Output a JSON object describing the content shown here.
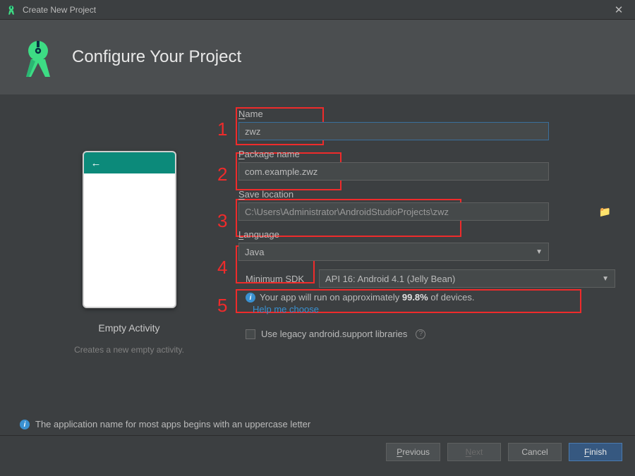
{
  "window": {
    "title": "Create New Project"
  },
  "header": {
    "title": "Configure Your Project"
  },
  "preview": {
    "template_name": "Empty Activity",
    "template_desc": "Creates a new empty activity."
  },
  "fields": {
    "name": {
      "label_pre": "N",
      "label_rest": "ame",
      "value": "zwz"
    },
    "package": {
      "label_pre": "P",
      "label_rest": "ackage name",
      "value": "com.example.zwz"
    },
    "location": {
      "label_pre": "S",
      "label_rest": "ave location",
      "value": "C:\\Users\\Administrator\\AndroidStudioProjects\\zwz"
    },
    "language": {
      "label_pre": "L",
      "label_rest": "anguage",
      "value": "Java"
    },
    "min_sdk": {
      "label": "Minimum SDK",
      "value": "API 16: Android 4.1 (Jelly Bean)"
    }
  },
  "sdk_info": {
    "text_pre": "Your app will run on approximately ",
    "percent": "99.8%",
    "text_post": " of devices.",
    "help_link": "Help me choose"
  },
  "legacy": {
    "label": "Use legacy android.support libraries"
  },
  "hint": {
    "text": "The application name for most apps begins with an uppercase letter"
  },
  "footer": {
    "previous_pre": "P",
    "previous_rest": "revious",
    "next_pre": "N",
    "next_rest": "ext",
    "cancel": "Cancel",
    "finish_pre": "F",
    "finish_rest": "inish"
  },
  "annotations": {
    "n1": "1",
    "n2": "2",
    "n3": "3",
    "n4": "4",
    "n5": "5"
  }
}
